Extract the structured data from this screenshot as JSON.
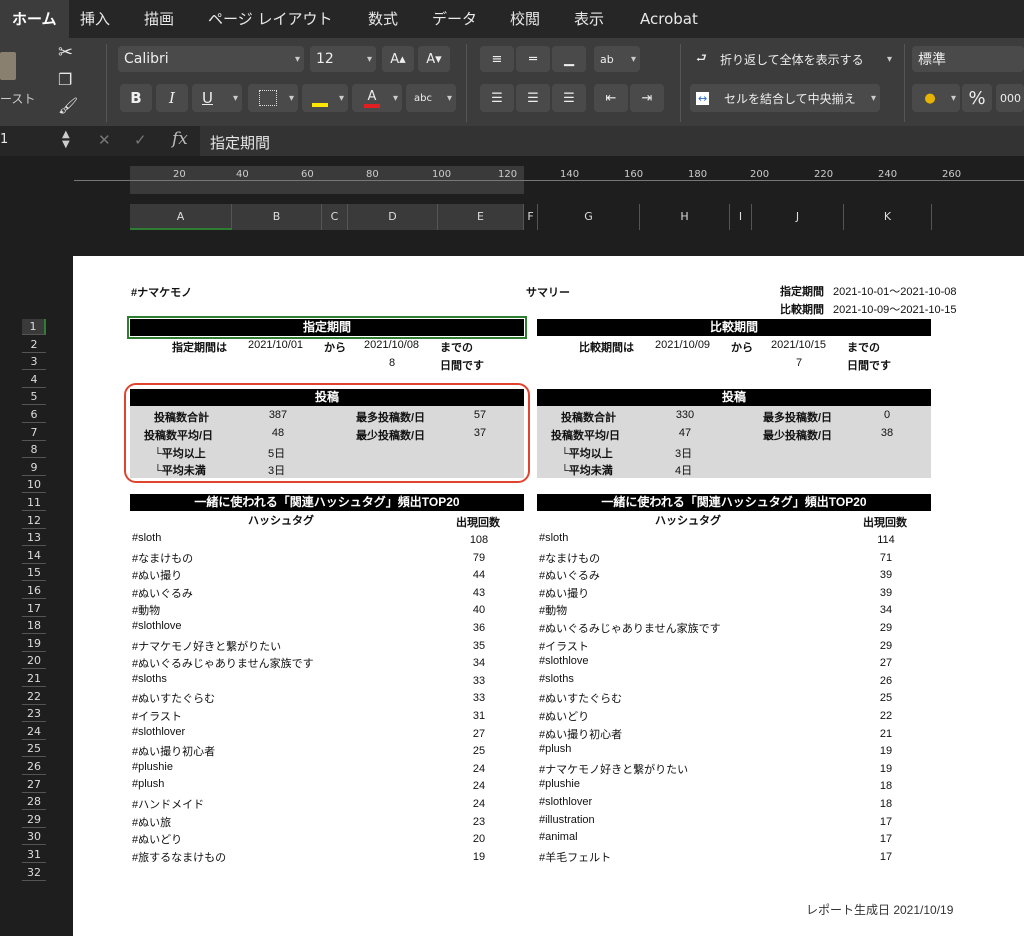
{
  "ribbon_tabs": [
    "ホーム",
    "挿入",
    "描画",
    "ページ レイアウト",
    "数式",
    "データ",
    "校閲",
    "表示",
    "Acrobat"
  ],
  "ribbon": {
    "paste_label": "ースト",
    "font_name": "Calibri",
    "font_size": "12",
    "grow_font": "A▴",
    "shrink_font": "A▾",
    "bold": "B",
    "italic": "I",
    "underline": "U",
    "wrap_text": "折り返して全体を表示する",
    "merge_center": "セルを結合して中央揃え",
    "number_format": "標準",
    "percent": "%",
    "comma": "000",
    "orientation_label": "ab",
    "phonetic_label": "abc"
  },
  "formula_bar": {
    "name_box": "1",
    "fx": "fx",
    "content": "指定期間"
  },
  "ruler_labels": [
    "20",
    "40",
    "60",
    "80",
    "100",
    "120",
    "140",
    "160",
    "180",
    "200",
    "220",
    "240",
    "260"
  ],
  "columns": [
    "A",
    "B",
    "C",
    "D",
    "E",
    "F",
    "G",
    "H",
    "I",
    "J",
    "K"
  ],
  "rows": [
    "1",
    "2",
    "3",
    "4",
    "5",
    "6",
    "7",
    "8",
    "9",
    "10",
    "11",
    "12",
    "13",
    "14",
    "15",
    "16",
    "17",
    "18",
    "19",
    "20",
    "21",
    "22",
    "23",
    "24",
    "25",
    "26",
    "27",
    "28",
    "29",
    "30",
    "31",
    "32"
  ],
  "report": {
    "account": "#ナマケモノ",
    "title": "サマリー",
    "period_label": "指定期間",
    "period_value": "2021-10-01〜2021-10-08",
    "compare_label": "比較期間",
    "compare_value": "2021-10-09〜2021-10-15",
    "left": {
      "header": "指定期間",
      "period_is": "指定期間は",
      "start": "2021/10/01",
      "from": "から",
      "end": "2021/10/08",
      "until": "までの",
      "days": "8",
      "days_label": "日間です",
      "posts_header": "投稿",
      "total_label": "投稿数合計",
      "total": "387",
      "max_label": "最多投稿数/日",
      "max": "57",
      "avg_label": "投稿数平均/日",
      "avg": "48",
      "min_label": "最少投稿数/日",
      "min": "37",
      "above_label": "└平均以上",
      "above": "5日",
      "below_label": "└平均未満",
      "below": "3日",
      "tags_header": "一緒に使われる「関連ハッシュタグ」頻出TOP20",
      "col_tag": "ハッシュタグ",
      "col_count": "出現回数",
      "tags": [
        {
          "tag": "#sloth",
          "n": "108"
        },
        {
          "tag": "#なまけもの",
          "n": "79"
        },
        {
          "tag": "#ぬい撮り",
          "n": "44"
        },
        {
          "tag": "#ぬいぐるみ",
          "n": "43"
        },
        {
          "tag": "#動物",
          "n": "40"
        },
        {
          "tag": "#slothlove",
          "n": "36"
        },
        {
          "tag": "#ナマケモノ好きと繋がりたい",
          "n": "35"
        },
        {
          "tag": "#ぬいぐるみじゃありません家族です",
          "n": "34"
        },
        {
          "tag": "#sloths",
          "n": "33"
        },
        {
          "tag": "#ぬいすたぐらむ",
          "n": "33"
        },
        {
          "tag": "#イラスト",
          "n": "31"
        },
        {
          "tag": "#slothlover",
          "n": "27"
        },
        {
          "tag": "#ぬい撮り初心者",
          "n": "25"
        },
        {
          "tag": "#plushie",
          "n": "24"
        },
        {
          "tag": "#plush",
          "n": "24"
        },
        {
          "tag": "#ハンドメイド",
          "n": "24"
        },
        {
          "tag": "#ぬい旅",
          "n": "23"
        },
        {
          "tag": "#ぬいどり",
          "n": "20"
        },
        {
          "tag": "#旅するなまけもの",
          "n": "19"
        }
      ]
    },
    "right": {
      "header": "比較期間",
      "period_is": "比較期間は",
      "start": "2021/10/09",
      "from": "から",
      "end": "2021/10/15",
      "until": "までの",
      "days": "7",
      "days_label": "日間です",
      "posts_header": "投稿",
      "total_label": "投稿数合計",
      "total": "330",
      "max_label": "最多投稿数/日",
      "max": "0",
      "avg_label": "投稿数平均/日",
      "avg": "47",
      "min_label": "最少投稿数/日",
      "min": "38",
      "above_label": "└平均以上",
      "above": "3日",
      "below_label": "└平均未満",
      "below": "4日",
      "tags_header": "一緒に使われる「関連ハッシュタグ」頻出TOP20",
      "col_tag": "ハッシュタグ",
      "col_count": "出現回数",
      "tags": [
        {
          "tag": "#sloth",
          "n": "114"
        },
        {
          "tag": "#なまけもの",
          "n": "71"
        },
        {
          "tag": "#ぬいぐるみ",
          "n": "39"
        },
        {
          "tag": "#ぬい撮り",
          "n": "39"
        },
        {
          "tag": "#動物",
          "n": "34"
        },
        {
          "tag": "#ぬいぐるみじゃありません家族です",
          "n": "29"
        },
        {
          "tag": "#イラスト",
          "n": "29"
        },
        {
          "tag": "#slothlove",
          "n": "27"
        },
        {
          "tag": "#sloths",
          "n": "26"
        },
        {
          "tag": "#ぬいすたぐらむ",
          "n": "25"
        },
        {
          "tag": "#ぬいどり",
          "n": "22"
        },
        {
          "tag": "#ぬい撮り初心者",
          "n": "21"
        },
        {
          "tag": "#plush",
          "n": "19"
        },
        {
          "tag": "#ナマケモノ好きと繋がりたい",
          "n": "19"
        },
        {
          "tag": "#plushie",
          "n": "18"
        },
        {
          "tag": "#slothlover",
          "n": "18"
        },
        {
          "tag": "#illustration",
          "n": "17"
        },
        {
          "tag": "#animal",
          "n": "17"
        },
        {
          "tag": "#羊毛フェルト",
          "n": "17"
        }
      ]
    },
    "generated": "レポート生成日 2021/10/19"
  },
  "colors": {
    "highlight": "#e0442f",
    "selection": "#2e7d32",
    "grey_fill": "#d9d9d9"
  }
}
